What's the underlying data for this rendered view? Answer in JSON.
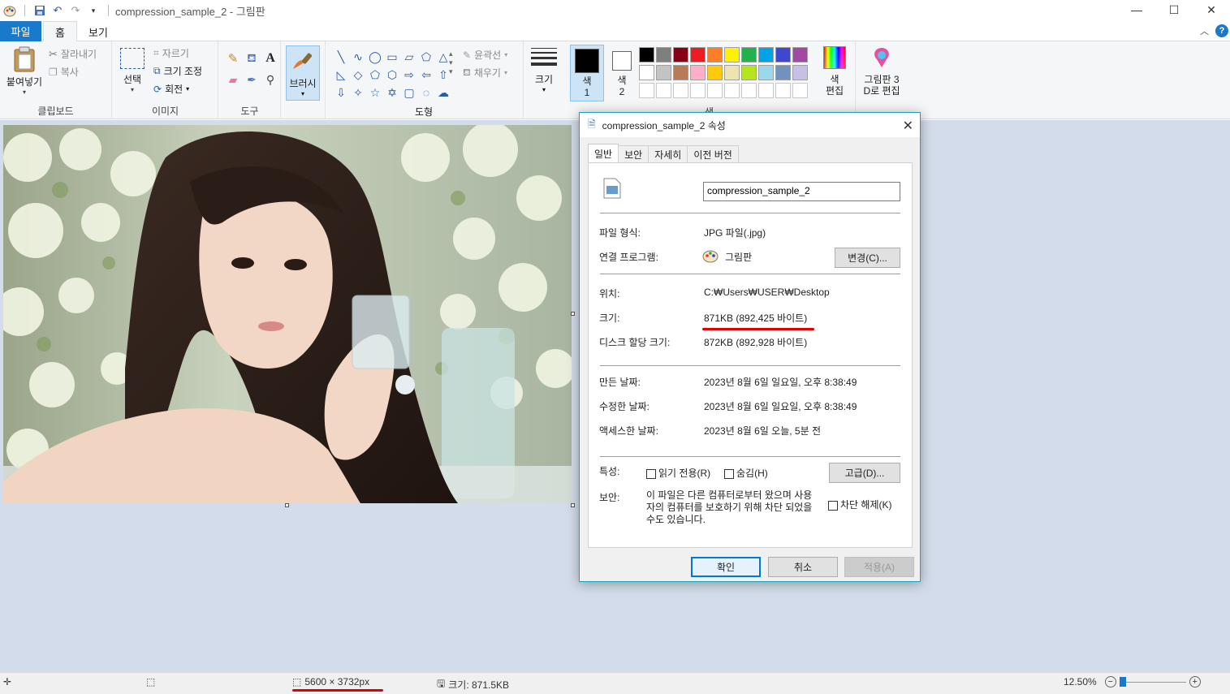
{
  "window": {
    "title": "compression_sample_2 - 그림판"
  },
  "tabs": {
    "file": "파일",
    "home": "홈",
    "view": "보기"
  },
  "ribbon": {
    "clipboard": {
      "paste": "붙여넣기",
      "cut": "잘라내기",
      "copy": "복사",
      "label": "클립보드"
    },
    "image": {
      "select": "선택",
      "crop": "자르기",
      "resize": "크기 조정",
      "rotate": "회전",
      "label": "이미지"
    },
    "tools": {
      "label": "도구"
    },
    "brush": {
      "label": "브러시"
    },
    "shapes": {
      "outline": "윤곽선",
      "fill": "채우기",
      "label": "도형"
    },
    "size": {
      "label": "크기"
    },
    "color1": {
      "label_line1": "색",
      "label_line2": "1"
    },
    "color2": {
      "label_line1": "색",
      "label_line2": "2"
    },
    "edit_colors": {
      "label_line1": "색",
      "label_line2": "편집"
    },
    "paint3d": {
      "label_line1": "그림판 3",
      "label_line2": "D로 편집"
    },
    "colors_group_label": "색",
    "palette": [
      "#000000",
      "#7f7f7f",
      "#880015",
      "#ed1c24",
      "#ff7f27",
      "#fff200",
      "#22b14c",
      "#00a2e8",
      "#3f48cc",
      "#a349a4",
      "#ffffff",
      "#c3c3c3",
      "#b97a57",
      "#ffaec9",
      "#ffc90e",
      "#efe4b0",
      "#b5e61d",
      "#99d9ea",
      "#7092be",
      "#c8bfe7"
    ]
  },
  "status": {
    "dimensions": "5600 × 3732px",
    "size": "크기: 871.5KB",
    "zoom": "12.50%"
  },
  "dialog": {
    "title": "compression_sample_2 속성",
    "tabs": [
      "일반",
      "보안",
      "자세히",
      "이전 버전"
    ],
    "filename": "compression_sample_2",
    "file_type_label": "파일 형식:",
    "file_type_value": "JPG 파일(.jpg)",
    "opens_with_label": "연결 프로그램:",
    "opens_with_value": "그림판",
    "change_button": "변경(C)...",
    "location_label": "위치:",
    "location_value": "C:₩Users₩USER₩Desktop",
    "size_label": "크기:",
    "size_value": "871KB (892,425 바이트)",
    "disk_size_label": "디스크 할당 크기:",
    "disk_size_value": "872KB (892,928 바이트)",
    "created_label": "만든 날짜:",
    "created_value": "2023년 8월 6일 일요일, 오후 8:38:49",
    "modified_label": "수정한 날짜:",
    "modified_value": "2023년 8월 6일 일요일, 오후 8:38:49",
    "accessed_label": "액세스한 날짜:",
    "accessed_value": "2023년 8월 6일 오늘, 5분 전",
    "attributes_label": "특성:",
    "readonly_label": "읽기 전용(R)",
    "hidden_label": "숨김(H)",
    "advanced_button": "고급(D)...",
    "security_label": "보안:",
    "security_text": "이 파일은 다른 컴퓨터로부터 왔으며 사용자의 컴퓨터를 보호하기 위해 차단 되었을 수도 있습니다.",
    "unblock_label": "차단 해제(K)",
    "ok_button": "확인",
    "cancel_button": "취소",
    "apply_button": "적용(A)"
  }
}
